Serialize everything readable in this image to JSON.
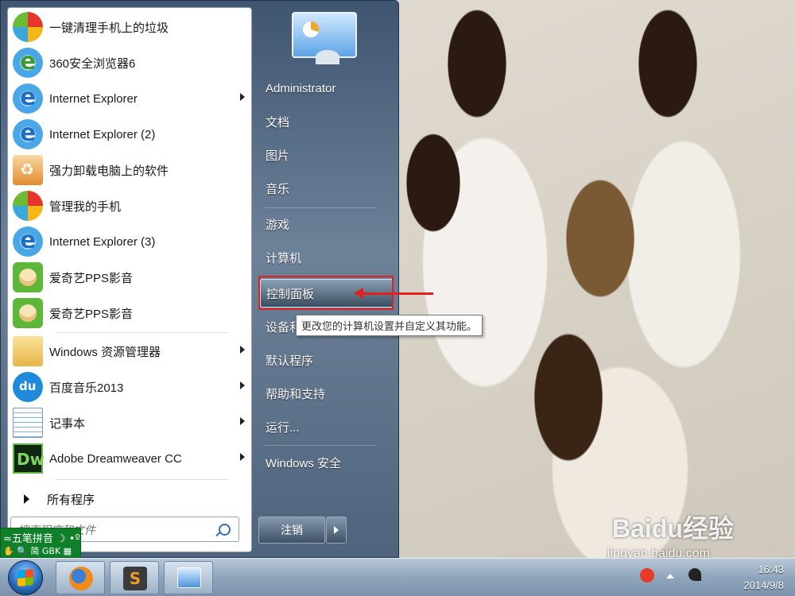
{
  "start_menu": {
    "programs": [
      {
        "label": "一键清理手机上的垃圾",
        "icon": "phone-cleaner-icon",
        "arrow": false
      },
      {
        "label": "360安全浏览器6",
        "icon": "360-browser-icon",
        "arrow": false
      },
      {
        "label": "Internet Explorer",
        "icon": "internet-explorer-icon",
        "arrow": true
      },
      {
        "label": "Internet Explorer (2)",
        "icon": "internet-explorer-icon",
        "arrow": false
      },
      {
        "label": "强力卸载电脑上的软件",
        "icon": "uninstaller-icon",
        "arrow": false
      },
      {
        "label": "管理我的手机",
        "icon": "phone-manager-icon",
        "arrow": false
      },
      {
        "label": "Internet Explorer (3)",
        "icon": "internet-explorer-icon",
        "arrow": false
      },
      {
        "label": "爱奇艺PPS影音",
        "icon": "pps-player-icon",
        "arrow": false
      },
      {
        "label": "爱奇艺PPS影音",
        "icon": "pps-player-icon",
        "arrow": false
      },
      {
        "label": "Windows 资源管理器",
        "icon": "folder-explorer-icon",
        "arrow": true
      },
      {
        "label": "百度音乐2013",
        "icon": "baidu-music-icon",
        "arrow": true
      },
      {
        "label": "记事本",
        "icon": "notepad-icon",
        "arrow": true
      },
      {
        "label": "Adobe Dreamweaver CC",
        "icon": "dreamweaver-icon",
        "arrow": true
      }
    ],
    "all_programs": "所有程序",
    "search_placeholder": "搜索程序和文件",
    "right_items": [
      {
        "label": "Administrator"
      },
      {
        "label": "文档"
      },
      {
        "label": "图片"
      },
      {
        "label": "音乐"
      },
      {
        "label": "游戏"
      },
      {
        "label": "计算机"
      },
      {
        "label": "控制面板"
      },
      {
        "label": "设备和打印机"
      },
      {
        "label": "默认程序"
      },
      {
        "label": "帮助和支持"
      },
      {
        "label": "运行..."
      },
      {
        "label": "Windows 安全"
      }
    ],
    "tooltip": "更改您的计算机设置并自定义其功能。",
    "logoff_label": "注销"
  },
  "ime": {
    "row1": "≈五笔拼音 ☽ •º",
    "row2": "✋ 🔍 简 GBK ▦"
  },
  "taskbar": {
    "time": "16:43",
    "date": "2014/9/8",
    "sublime_glyph": "S"
  },
  "watermark": {
    "brand": "Baidu经验",
    "url": "jingyan.baidu.com"
  },
  "colors": {
    "highlight": "#e02020",
    "start_menu_bg": "#4d647c"
  }
}
